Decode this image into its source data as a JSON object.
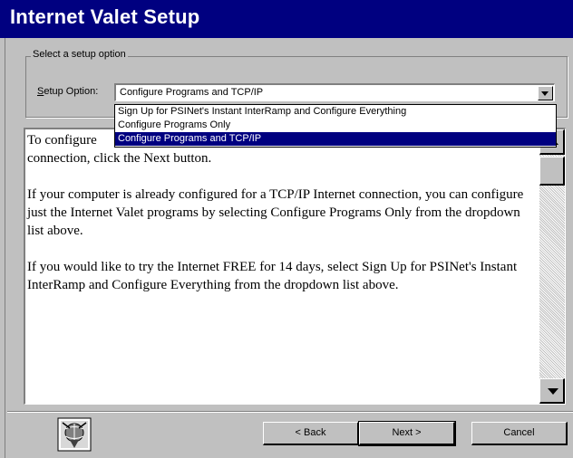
{
  "window": {
    "title": "Internet Valet Setup"
  },
  "setup_group": {
    "legend": "Select a setup option",
    "label_prefix": "S",
    "label_rest": "etup Option:",
    "selected_value": "Configure Programs and TCP/IP",
    "options": [
      "Sign Up for PSINet's Instant InterRamp and Configure Everything",
      "Configure Programs Only",
      "Configure Programs and TCP/IP"
    ]
  },
  "description": {
    "para1_line1_visible": "To configure",
    "para1_line2": "connection, click the Next button.",
    "para2": "If your computer is already configured for a TCP/IP Internet connection, you can configure just the Internet Valet programs by selecting Configure Programs Only from the dropdown list above.",
    "para3": "If you would like to try the Internet FREE for 14 days, select Sign Up for PSINet's Instant InterRamp and Configure Everything from the dropdown list above."
  },
  "buttons": {
    "back": "< Back",
    "next": "Next >",
    "cancel": "Cancel"
  },
  "icons": {
    "logo": "internet-valet-logo-icon",
    "dropdown": "chevron-down-icon",
    "scroll_up": "scroll-up-arrow-icon",
    "scroll_down": "scroll-down-arrow-icon"
  }
}
